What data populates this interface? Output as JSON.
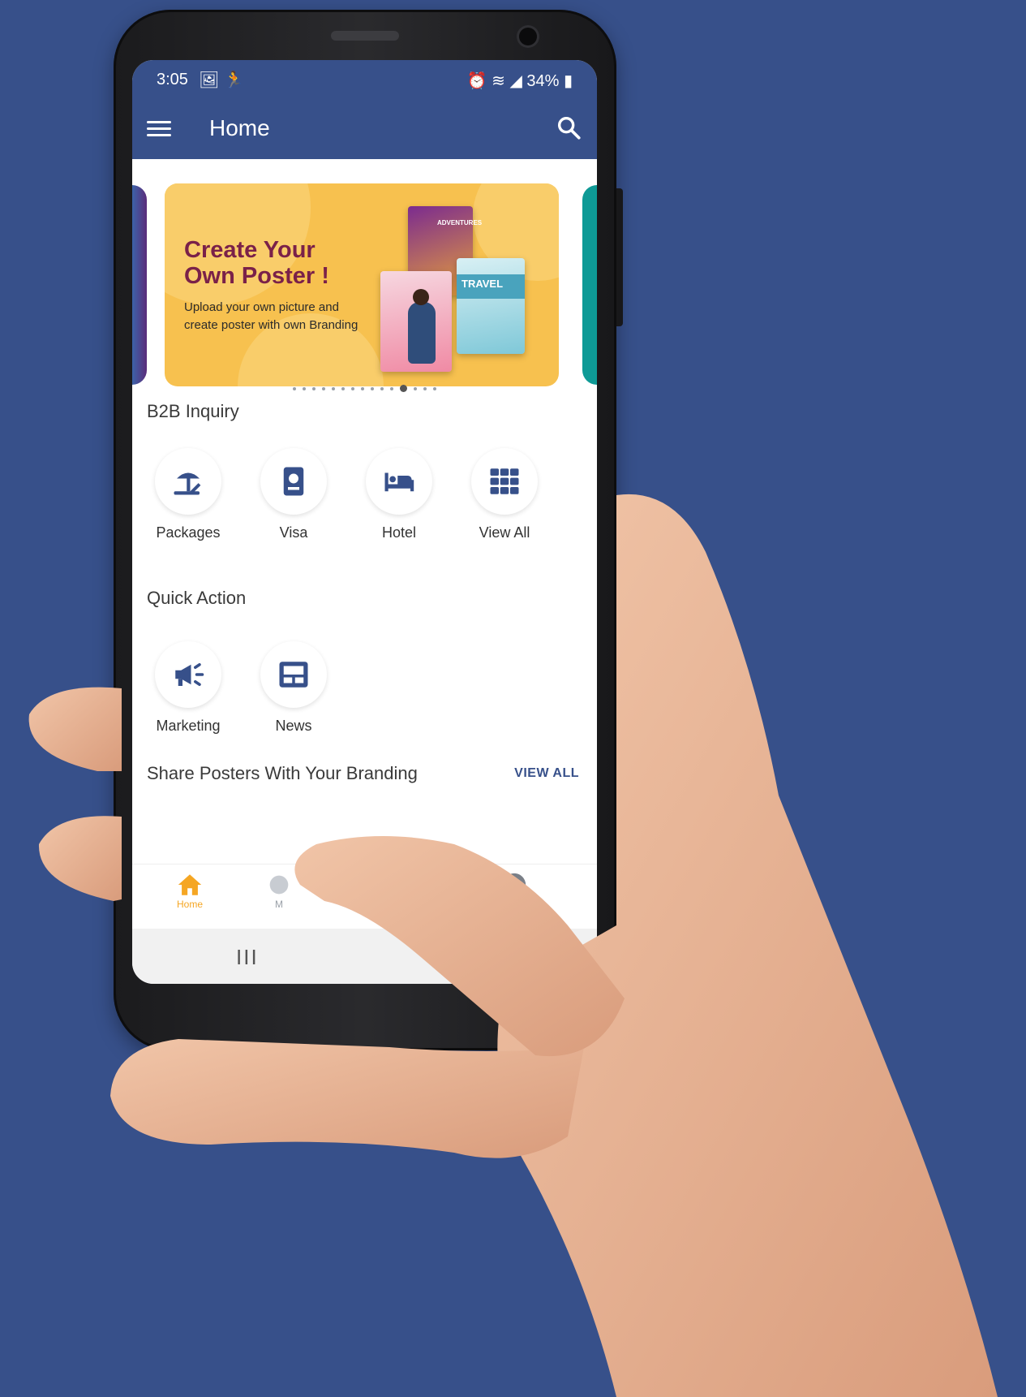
{
  "status_bar": {
    "time": "3:05",
    "left_icons": "🖼 🏃",
    "right": "⏰ ≋ ◢ 34% ▮"
  },
  "app_bar": {
    "title": "Home"
  },
  "banner": {
    "title": "Create Your\nOwn Poster !",
    "subtitle": "Upload your own picture and\ncreate poster with own Branding",
    "poster_labels": [
      "ADVENTURES",
      "TRAVEL"
    ]
  },
  "carousel": {
    "total_pages": 15,
    "active_page": 11
  },
  "b2b": {
    "title": "B2B Inquiry",
    "items": [
      {
        "label": "Packages",
        "icon": "beach-umbrella-icon"
      },
      {
        "label": "Visa",
        "icon": "passport-icon"
      },
      {
        "label": "Hotel",
        "icon": "bed-icon"
      },
      {
        "label": "View All",
        "icon": "grid-icon"
      }
    ]
  },
  "quick_action": {
    "title": "Quick Action",
    "items": [
      {
        "label": "Marketing",
        "icon": "megaphone-icon"
      },
      {
        "label": "News",
        "icon": "newspaper-icon"
      }
    ]
  },
  "posters_section": {
    "title": "Share Posters With Your Branding",
    "view_all": "VIEW ALL"
  },
  "bottom_nav": {
    "home_label": "Home",
    "second_label": "M"
  },
  "system_nav": {
    "recents": "III"
  },
  "colors": {
    "primary": "#37508a",
    "accent": "#f5a623",
    "banner": "#f7c14f"
  }
}
